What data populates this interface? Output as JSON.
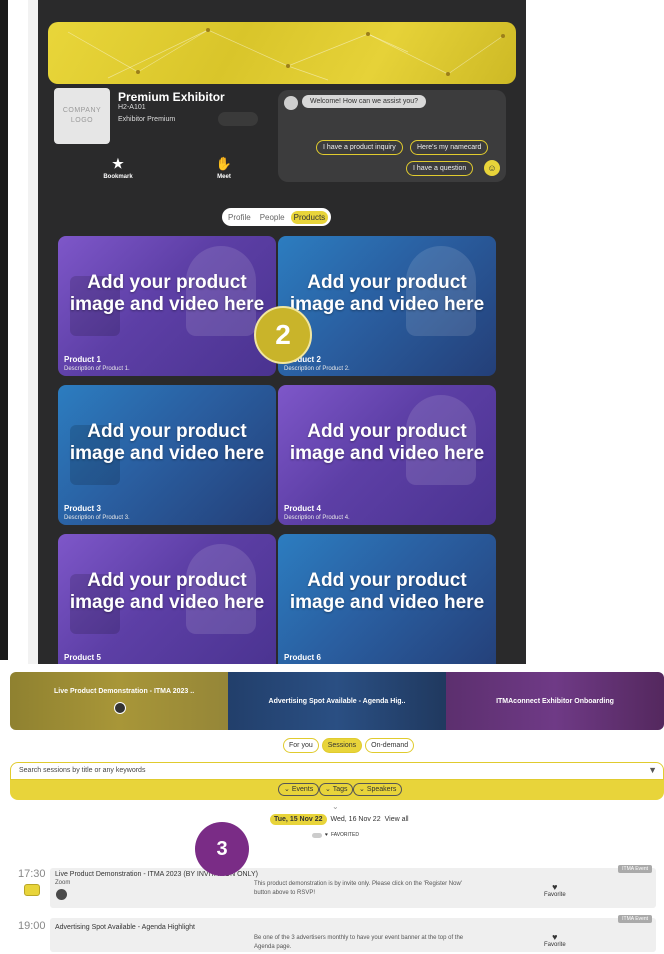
{
  "exhibitor": {
    "logo_text": "COMPANY LOGO",
    "name": "Premium Exhibitor",
    "booth": "H2-A101",
    "tier": "Exhibitor Premium",
    "actions": {
      "bookmark": "Bookmark",
      "meet": "Meet"
    }
  },
  "chat": {
    "greeting": "Welcome! How can we assist you?",
    "options": [
      "I have a product inquiry",
      "Here's my namecard",
      "I have a question"
    ]
  },
  "profile_tabs": [
    {
      "label": "Profile",
      "active": false
    },
    {
      "label": "People",
      "active": false
    },
    {
      "label": "Products",
      "active": true
    }
  ],
  "products": [
    {
      "headline": "Add your product image and video here",
      "name": "Product 1",
      "desc": "Description of Product 1."
    },
    {
      "headline": "Add your product image and video here",
      "name": "Product 2",
      "desc": "Description of Product 2."
    },
    {
      "headline": "Add your product image and video here",
      "name": "Product 3",
      "desc": "Description of Product 3."
    },
    {
      "headline": "Add your product image and video here",
      "name": "Product 4",
      "desc": "Description of Product 4."
    },
    {
      "headline": "Add your product image and video here",
      "name": "Product 5",
      "desc": ""
    },
    {
      "headline": "Add your product image and video here",
      "name": "Product 6",
      "desc": ""
    }
  ],
  "step_markers": {
    "two": "2",
    "three": "3"
  },
  "hero_slides": [
    "Live Product Demonstration - ITMA 2023 ..",
    "Advertising Spot Available - Agenda Hig..",
    "ITMAconnect Exhibitor Onboarding"
  ],
  "agenda_tabs": [
    {
      "label": "For you",
      "active": false
    },
    {
      "label": "Sessions",
      "active": true
    },
    {
      "label": "On-demand",
      "active": false
    }
  ],
  "search": {
    "placeholder": "Search sessions by title or any keywords"
  },
  "filters": [
    "Events",
    "Tags",
    "Speakers"
  ],
  "dates": [
    {
      "label": "Tue, 15 Nov 22",
      "active": true
    },
    {
      "label": "Wed, 16 Nov 22",
      "active": false
    },
    {
      "label": "View all",
      "active": false
    }
  ],
  "favorited_label": "FAVORITED",
  "sessions": [
    {
      "time": "17:30",
      "title": "Live Product Demonstration - ITMA 2023 (BY INVITATION ONLY)",
      "location": "Zoom",
      "desc": "This product demonstration is by invite only. Please click on the 'Register Now' button above to RSVP!",
      "badge": "ITMA Event",
      "fav": "Favorite"
    },
    {
      "time": "19:00",
      "title": "Advertising Spot Available - Agenda Highlight",
      "location": "",
      "desc": "Be one of the 3 advertisers monthly to have your event banner at the top of the Agenda page.",
      "badge": "ITMA Event",
      "fav": "Favorite"
    }
  ],
  "colors": {
    "accent": "#e8d43a",
    "panel": "#2a2a2b",
    "purple": "#7a2c86"
  }
}
